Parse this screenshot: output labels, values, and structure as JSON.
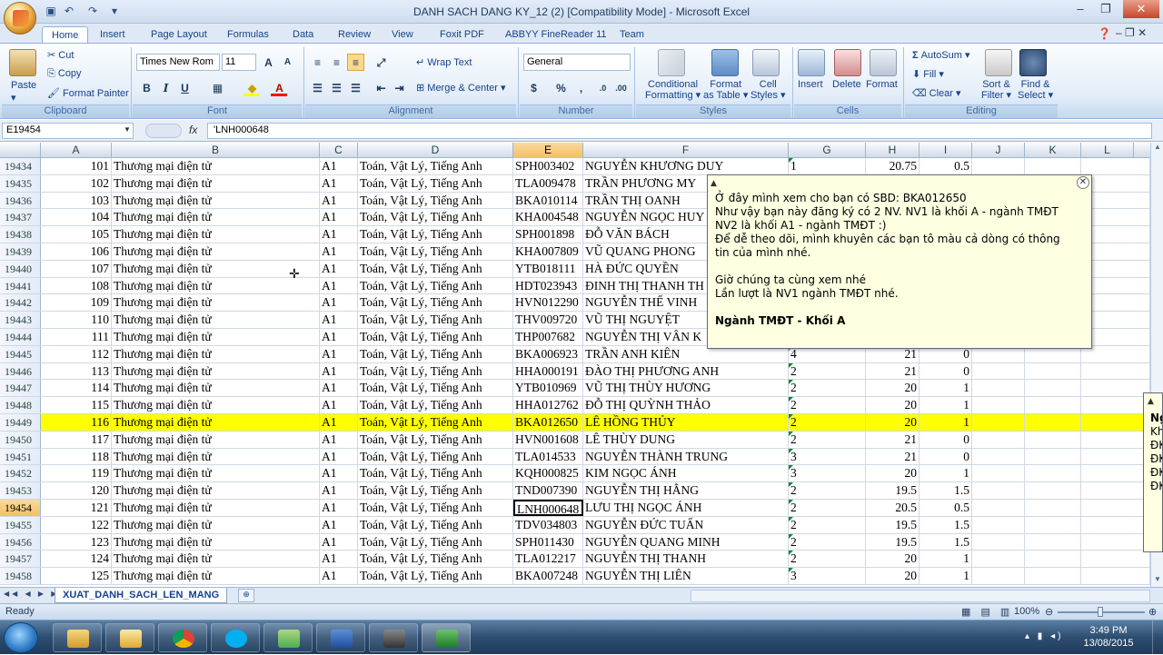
{
  "window": {
    "title": "DANH SACH DANG KY_12 (2)  [Compatibility Mode] - Microsoft Excel"
  },
  "tabs": [
    "Home",
    "Insert",
    "Page Layout",
    "Formulas",
    "Data",
    "Review",
    "View",
    "Foxit PDF",
    "ABBYY FineReader 11",
    "Team"
  ],
  "ribbon": {
    "clipboard": {
      "label": "Clipboard",
      "paste": "Paste",
      "cut": "Cut",
      "copy": "Copy",
      "format_painter": "Format Painter"
    },
    "font": {
      "label": "Font",
      "name": "Times New Rom",
      "size": "11"
    },
    "alignment": {
      "label": "Alignment",
      "wrap": "Wrap Text",
      "merge": "Merge & Center"
    },
    "number": {
      "label": "Number",
      "format": "General",
      "currency": "$",
      "percent": "%",
      "comma": ","
    },
    "styles": {
      "label": "Styles",
      "cond_1": "Conditional",
      "cond_2": "Formatting",
      "fmt_table_1": "Format",
      "fmt_table_2": "as Table",
      "cell_styles_1": "Cell",
      "cell_styles_2": "Styles"
    },
    "cells": {
      "label": "Cells",
      "insert": "Insert",
      "delete": "Delete",
      "format": "Format"
    },
    "editing": {
      "label": "Editing",
      "autosum": "AutoSum",
      "fill": "Fill",
      "clear": "Clear",
      "sort_1": "Sort &",
      "sort_2": "Filter",
      "find_1": "Find &",
      "find_2": "Select"
    }
  },
  "formula_bar": {
    "name_box": "E19454",
    "fx": "fx",
    "formula": "'LNH000648"
  },
  "columns": [
    "A",
    "B",
    "C",
    "D",
    "E",
    "F",
    "G",
    "H",
    "I",
    "J",
    "K",
    "L"
  ],
  "rows": [
    {
      "r": "19434",
      "a": "101",
      "b": "Thương mại điện tử",
      "c": "A1",
      "d": "Toán, Vật Lý, Tiếng Anh",
      "e": "SPH003402",
      "f": "NGUYỄN KHƯƠNG DUY",
      "g": "1",
      "h": "20.75",
      "i": "0.5"
    },
    {
      "r": "19435",
      "a": "102",
      "b": "Thương mại điện tử",
      "c": "A1",
      "d": "Toán, Vật Lý, Tiếng Anh",
      "e": "TLA009478",
      "f": "TRẦN PHƯƠNG MY",
      "g": "",
      "h": "",
      "i": ""
    },
    {
      "r": "19436",
      "a": "103",
      "b": "Thương mại điện tử",
      "c": "A1",
      "d": "Toán, Vật Lý, Tiếng Anh",
      "e": "BKA010114",
      "f": "TRẦN THỊ OANH",
      "g": "",
      "h": "",
      "i": ""
    },
    {
      "r": "19437",
      "a": "104",
      "b": "Thương mại điện tử",
      "c": "A1",
      "d": "Toán, Vật Lý, Tiếng Anh",
      "e": "KHA004548",
      "f": "NGUYỄN NGỌC HUY",
      "g": "",
      "h": "",
      "i": ""
    },
    {
      "r": "19438",
      "a": "105",
      "b": "Thương mại điện tử",
      "c": "A1",
      "d": "Toán, Vật Lý, Tiếng Anh",
      "e": "SPH001898",
      "f": "ĐỖ VĂN BÁCH",
      "g": "",
      "h": "",
      "i": ""
    },
    {
      "r": "19439",
      "a": "106",
      "b": "Thương mại điện tử",
      "c": "A1",
      "d": "Toán, Vật Lý, Tiếng Anh",
      "e": "KHA007809",
      "f": "VŨ QUANG PHONG",
      "g": "",
      "h": "",
      "i": ""
    },
    {
      "r": "19440",
      "a": "107",
      "b": "Thương mại điện tử",
      "c": "A1",
      "d": "Toán, Vật Lý, Tiếng Anh",
      "e": "YTB018111",
      "f": "HÀ ĐỨC QUYỀN",
      "g": "",
      "h": "",
      "i": ""
    },
    {
      "r": "19441",
      "a": "108",
      "b": "Thương mại điện tử",
      "c": "A1",
      "d": "Toán, Vật Lý, Tiếng Anh",
      "e": "HDT023943",
      "f": "ĐINH THỊ THANH TH",
      "g": "",
      "h": "",
      "i": ""
    },
    {
      "r": "19442",
      "a": "109",
      "b": "Thương mại điện tử",
      "c": "A1",
      "d": "Toán, Vật Lý, Tiếng Anh",
      "e": "HVN012290",
      "f": "NGUYỄN THẾ VINH",
      "g": "",
      "h": "",
      "i": ""
    },
    {
      "r": "19443",
      "a": "110",
      "b": "Thương mại điện tử",
      "c": "A1",
      "d": "Toán, Vật Lý, Tiếng Anh",
      "e": "THV009720",
      "f": "VŨ THỊ NGUYỆT",
      "g": "",
      "h": "",
      "i": ""
    },
    {
      "r": "19444",
      "a": "111",
      "b": "Thương mại điện tử",
      "c": "A1",
      "d": "Toán, Vật Lý, Tiếng Anh",
      "e": "THP007682",
      "f": "NGUYỄN THỊ VÂN K",
      "g": "",
      "h": "",
      "i": ""
    },
    {
      "r": "19445",
      "a": "112",
      "b": "Thương mại điện tử",
      "c": "A1",
      "d": "Toán, Vật Lý, Tiếng Anh",
      "e": "BKA006923",
      "f": "TRẦN ANH KIÊN",
      "g": "4",
      "h": "21",
      "i": "0"
    },
    {
      "r": "19446",
      "a": "113",
      "b": "Thương mại điện tử",
      "c": "A1",
      "d": "Toán, Vật Lý, Tiếng Anh",
      "e": "HHA000191",
      "f": "ĐÀO THỊ PHƯƠNG ANH",
      "g": "2",
      "h": "21",
      "i": "0"
    },
    {
      "r": "19447",
      "a": "114",
      "b": "Thương mại điện tử",
      "c": "A1",
      "d": "Toán, Vật Lý, Tiếng Anh",
      "e": "YTB010969",
      "f": "VŨ THỊ THÙY HƯƠNG",
      "g": "2",
      "h": "20",
      "i": "1"
    },
    {
      "r": "19448",
      "a": "115",
      "b": "Thương mại điện tử",
      "c": "A1",
      "d": "Toán, Vật Lý, Tiếng Anh",
      "e": "HHA012762",
      "f": "ĐỖ THỊ QUỲNH THẢO",
      "g": "2",
      "h": "20",
      "i": "1"
    },
    {
      "r": "19449",
      "a": "116",
      "b": "Thương mại điện tử",
      "c": "A1",
      "d": "Toán, Vật Lý, Tiếng Anh",
      "e": "BKA012650",
      "f": "LÊ HỒNG THỦY",
      "g": "2",
      "h": "20",
      "i": "1"
    },
    {
      "r": "19450",
      "a": "117",
      "b": "Thương mại điện tử",
      "c": "A1",
      "d": "Toán, Vật Lý, Tiếng Anh",
      "e": "HVN001608",
      "f": "LÊ THÙY DUNG",
      "g": "2",
      "h": "21",
      "i": "0"
    },
    {
      "r": "19451",
      "a": "118",
      "b": "Thương mại điện tử",
      "c": "A1",
      "d": "Toán, Vật Lý, Tiếng Anh",
      "e": "TLA014533",
      "f": "NGUYỄN THÀNH TRUNG",
      "g": "3",
      "h": "21",
      "i": "0"
    },
    {
      "r": "19452",
      "a": "119",
      "b": "Thương mại điện tử",
      "c": "A1",
      "d": "Toán, Vật Lý, Tiếng Anh",
      "e": "KQH000825",
      "f": "KIM NGỌC ÁNH",
      "g": "3",
      "h": "20",
      "i": "1"
    },
    {
      "r": "19453",
      "a": "120",
      "b": "Thương mại điện tử",
      "c": "A1",
      "d": "Toán, Vật Lý, Tiếng Anh",
      "e": "TND007390",
      "f": "NGUYỄN THỊ HẰNG",
      "g": "2",
      "h": "19.5",
      "i": "1.5"
    },
    {
      "r": "19454",
      "a": "121",
      "b": "Thương mại điện tử",
      "c": "A1",
      "d": "Toán, Vật Lý, Tiếng Anh",
      "e": "LNH000648",
      "f": "LƯU THỊ NGỌC ÁNH",
      "g": "2",
      "h": "20.5",
      "i": "0.5"
    },
    {
      "r": "19455",
      "a": "122",
      "b": "Thương mại điện tử",
      "c": "A1",
      "d": "Toán, Vật Lý, Tiếng Anh",
      "e": "TDV034803",
      "f": "NGUYỄN ĐỨC TUẤN",
      "g": "2",
      "h": "19.5",
      "i": "1.5"
    },
    {
      "r": "19456",
      "a": "123",
      "b": "Thương mại điện tử",
      "c": "A1",
      "d": "Toán, Vật Lý, Tiếng Anh",
      "e": "SPH011430",
      "f": "NGUYỄN QUANG MINH",
      "g": "2",
      "h": "19.5",
      "i": "1.5"
    },
    {
      "r": "19457",
      "a": "124",
      "b": "Thương mại điện tử",
      "c": "A1",
      "d": "Toán, Vật Lý, Tiếng Anh",
      "e": "TLA012217",
      "f": "NGUYỄN THỊ THANH",
      "g": "2",
      "h": "20",
      "i": "1"
    },
    {
      "r": "19458",
      "a": "125",
      "b": "Thương mại điện tử",
      "c": "A1",
      "d": "Toán, Vật Lý, Tiếng Anh",
      "e": "BKA007248",
      "f": "NGUYỄN THỊ LIÊN",
      "g": "3",
      "h": "20",
      "i": "1"
    }
  ],
  "highlight_row": "19449",
  "active_row": "19454",
  "highlight_color": "#ffff00",
  "comment": {
    "lines": [
      "Ở đây mình xem cho bạn có SBD: BKA012650",
      "Như vậy bạn này đăng ký có 2 NV. NV1 là khối A - ngành TMĐT",
      "NV2 là khối A1 - ngành TMĐT :)",
      "Để dễ theo dõi, mình khuyên các bạn tô màu cả dòng có thông",
      "tin của mình  nhé.",
      "",
      "Giờ chúng ta cùng xem nhé",
      "Lần lượt là NV1 ngành TMĐT nhé.",
      "",
      "Ngành TMĐT - Khối A"
    ]
  },
  "comment2": {
    "lines": [
      "Ng",
      "Kh",
      "ĐK",
      "ĐK",
      "ĐK",
      "ĐK"
    ]
  },
  "sheet": {
    "tab": "XUAT_DANH_SACH_LEN_MANG"
  },
  "status": {
    "ready": "Ready",
    "zoom": "100%"
  },
  "taskbar": {
    "time": "3:49 PM",
    "date": "13/08/2015"
  }
}
